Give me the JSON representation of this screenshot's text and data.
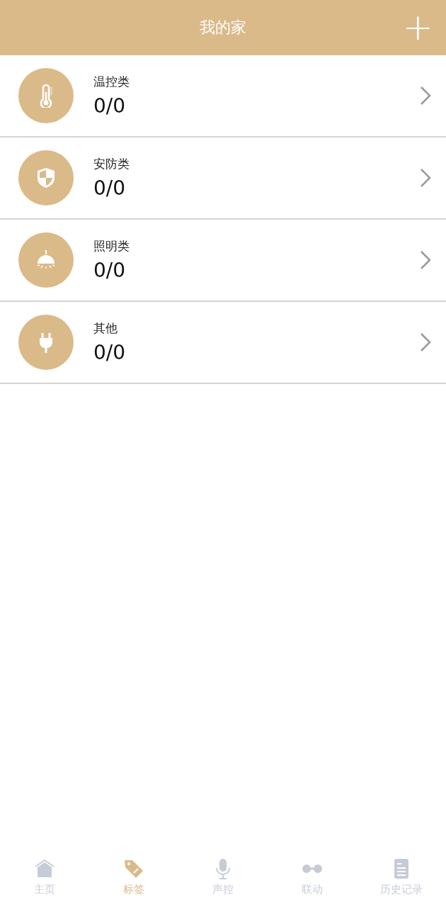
{
  "header": {
    "title": "我的家",
    "add_button": "+"
  },
  "categories": [
    {
      "name": "温控类",
      "count": "0/0"
    },
    {
      "name": "安防类",
      "count": "0/0"
    },
    {
      "name": "照明类",
      "count": "0/0"
    },
    {
      "name": "其他",
      "count": "0/0"
    }
  ],
  "tabs": [
    {
      "label": "主页",
      "selected": false
    },
    {
      "label": "标签",
      "selected": true
    },
    {
      "label": "声控",
      "selected": false
    },
    {
      "label": "联动",
      "selected": false
    },
    {
      "label": "历史记录",
      "selected": false
    }
  ]
}
